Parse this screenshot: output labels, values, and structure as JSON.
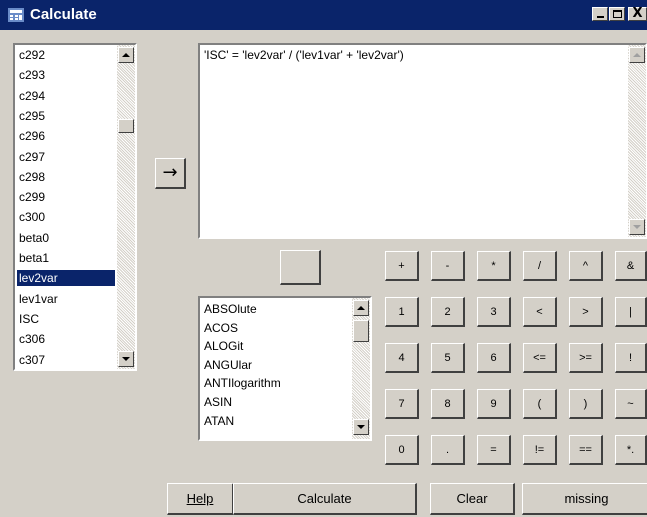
{
  "window": {
    "title": "Calculate",
    "minimize": "_",
    "maximize": "□",
    "close": "X"
  },
  "variables": {
    "items": [
      "c292",
      "c293",
      "c294",
      "c295",
      "c296",
      "c297",
      "c298",
      "c299",
      "c300",
      "beta0",
      "beta1",
      "lev2var",
      "lev1var",
      "ISC",
      "c306",
      "c307"
    ],
    "selected": "lev2var"
  },
  "insert_button": {
    "label": "→"
  },
  "expression": {
    "value": "'ISC' = 'lev2var' / ('lev1var' + 'lev2var')"
  },
  "functions": {
    "items": [
      "ABSOlute",
      "ACOS",
      "ALOGit",
      "ANGUlar",
      "ANTIlogarithm",
      "ASIN",
      "ATAN"
    ]
  },
  "keypad": {
    "row1": [
      "+",
      "-",
      "*",
      "/",
      "^",
      "&"
    ],
    "row2": [
      "1",
      "2",
      "3",
      "<",
      ">",
      "|"
    ],
    "row3": [
      "4",
      "5",
      "6",
      "<=",
      ">=",
      "!"
    ],
    "row4": [
      "7",
      "8",
      "9",
      "(",
      ")",
      "~"
    ],
    "row5": [
      "0",
      ".",
      "=",
      "!=",
      "==",
      "*."
    ]
  },
  "buttons": {
    "help": "Help",
    "calculate": "Calculate",
    "clear": "Clear",
    "missing": "missing"
  },
  "colors": {
    "titlebar": "#0a246a",
    "selection": "#0a246a",
    "face": "#d4d0c8"
  }
}
